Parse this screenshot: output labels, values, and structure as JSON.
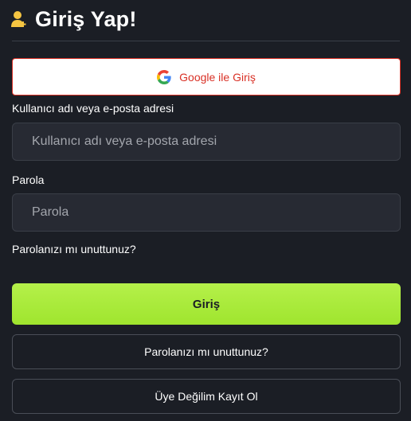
{
  "header": {
    "title": "Giriş Yap!",
    "icon": "user-plus-icon",
    "icon_color": "#f5c542"
  },
  "google_login": {
    "label": "Google ile Giriş",
    "icon": "google-icon",
    "accent": "#d93025"
  },
  "form": {
    "username": {
      "label": "Kullanıcı adı veya e-posta adresi",
      "placeholder": "Kullanıcı adı veya e-posta adresi",
      "value": ""
    },
    "password": {
      "label": "Parola",
      "placeholder": "Parola",
      "value": ""
    },
    "forgot_link": "Parolanızı mı unuttunuz?"
  },
  "actions": {
    "login_label": "Giriş",
    "login_color": "#a8e93a",
    "forgot_button_label": "Parolanızı mı unuttunuz?",
    "register_button_label": "Üye Değilim Kayıt Ol"
  }
}
